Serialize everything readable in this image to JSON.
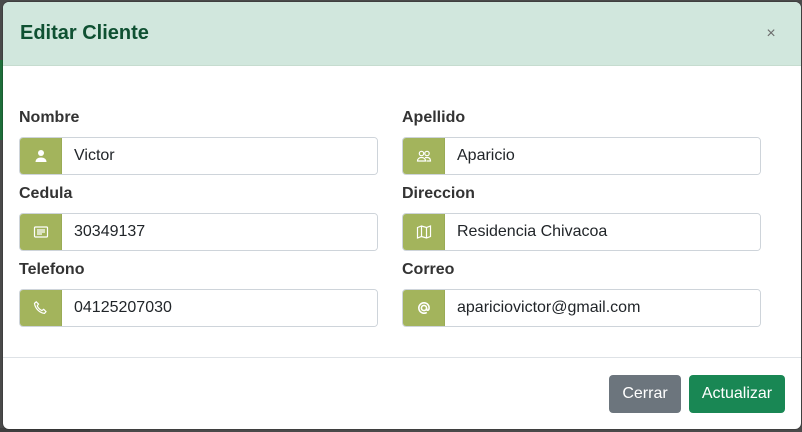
{
  "modal": {
    "title": "Editar Cliente",
    "close_label": "×"
  },
  "fields": {
    "nombre": {
      "label": "Nombre",
      "value": "Victor",
      "icon": "user-icon"
    },
    "apellido": {
      "label": "Apellido",
      "value": "Aparicio",
      "icon": "users-icon"
    },
    "cedula": {
      "label": "Cedula",
      "value": "30349137",
      "icon": "card-text-icon"
    },
    "direccion": {
      "label": "Direccion",
      "value": "Residencia Chivacoa",
      "icon": "map-icon"
    },
    "telefono": {
      "label": "Telefono",
      "value": "04125207030",
      "icon": "phone-icon"
    },
    "correo": {
      "label": "Correo",
      "value": "apariciovictor@gmail.com",
      "icon": "at-icon"
    }
  },
  "footer": {
    "close_button": "Cerrar",
    "update_button": "Actualizar"
  },
  "colors": {
    "header_bg": "#d1e7dd",
    "title_color": "#0f5132",
    "icon_bg": "#a3b45c",
    "secondary": "#6c757d",
    "success": "#198754"
  }
}
